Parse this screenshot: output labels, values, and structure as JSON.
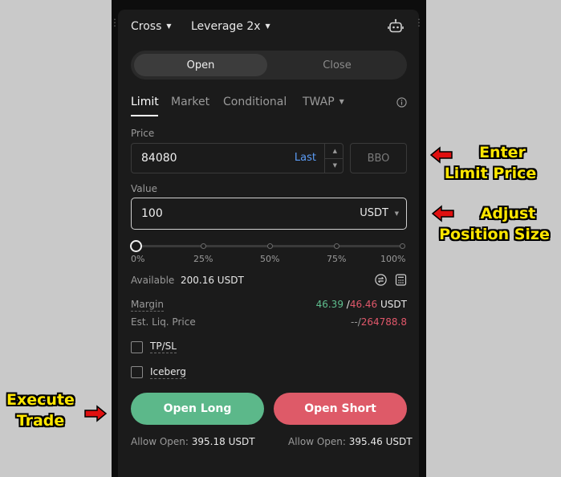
{
  "header": {
    "margin_mode": "Cross",
    "leverage": "Leverage 2x",
    "robot_icon": "robot-icon"
  },
  "position_toggle": {
    "open_label": "Open",
    "close_label": "Close"
  },
  "order_tabs": {
    "limit": "Limit",
    "market": "Market",
    "conditional": "Conditional",
    "twap": "TWAP"
  },
  "price": {
    "label": "Price",
    "value": "84080",
    "last_label": "Last",
    "bbo_label": "BBO"
  },
  "value_field": {
    "label": "Value",
    "value": "100",
    "unit": "USDT"
  },
  "slider": {
    "level_percent": 0,
    "ticks": [
      "0%",
      "25%",
      "50%",
      "75%",
      "100%"
    ]
  },
  "available": {
    "label": "Available",
    "value": "200.16 USDT"
  },
  "margin": {
    "label": "Margin",
    "long_value": "46.39",
    "separator": "/",
    "short_value": "46.46",
    "unit": "USDT"
  },
  "liq_price": {
    "label": "Est. Liq. Price",
    "long_value": "--",
    "separator": "/",
    "short_value": "264788.8"
  },
  "options": {
    "tpsl_label": "TP/SL",
    "iceberg_label": "Iceberg"
  },
  "actions": {
    "open_long": "Open Long",
    "open_short": "Open Short",
    "allow_open_label": "Allow Open:",
    "allow_long_value": "395.18 USDT",
    "allow_short_value": "395.46 USDT"
  },
  "annotations": {
    "limit_price_line1": "Enter",
    "limit_price_line2": "Limit Price",
    "position_size_line1": "Adjust",
    "position_size_line2": "Position Size",
    "execute_line1": "Execute",
    "execute_line2": "Trade"
  },
  "colors": {
    "long": "#5cb88a",
    "short": "#de5a68",
    "accent_blue": "#5b9cf6",
    "annotation": "#ffe600",
    "arrow": "#e01010"
  }
}
